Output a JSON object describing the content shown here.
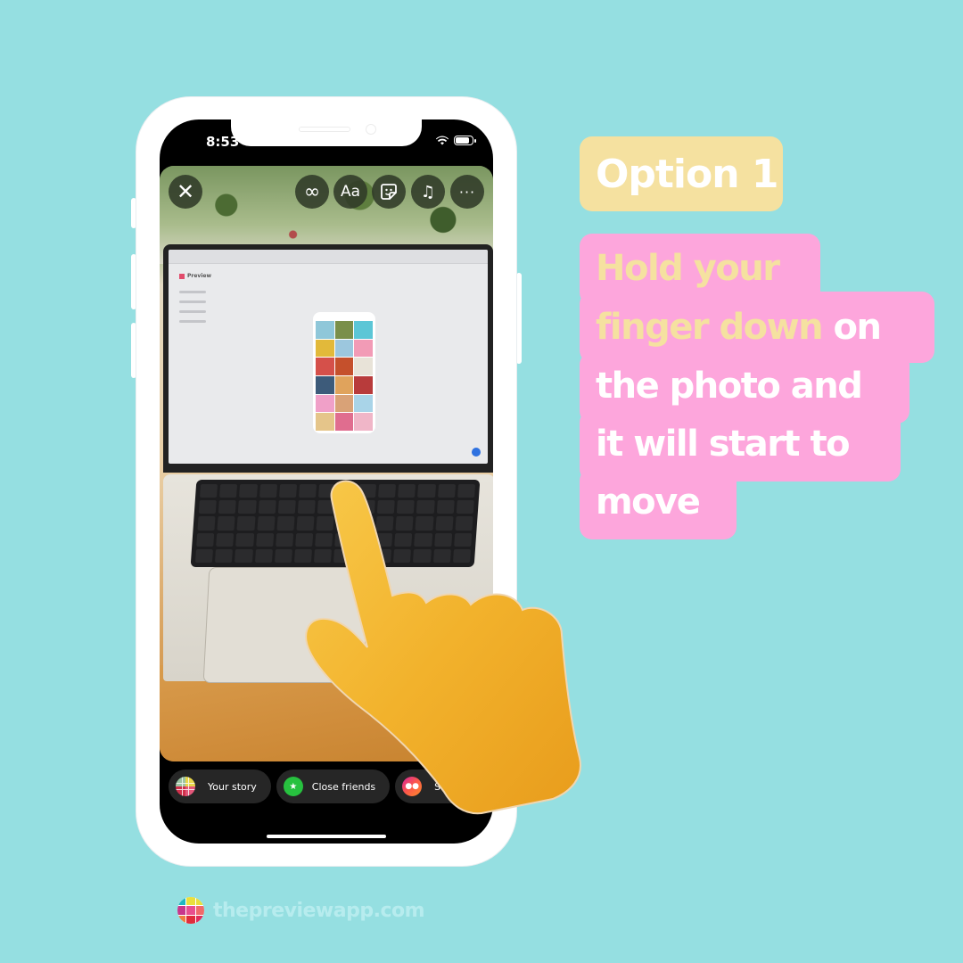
{
  "phone": {
    "status_bar": {
      "time": "8:53",
      "wifi_icon": "wifi-icon",
      "battery_icon": "battery-icon"
    },
    "story_editor": {
      "toolbar": [
        {
          "id": "close",
          "icon": "close-icon",
          "glyph": "✕"
        },
        {
          "id": "boomerang",
          "icon": "infinity-icon",
          "glyph": "∞"
        },
        {
          "id": "text",
          "icon": "text-icon",
          "glyph": "Aa"
        },
        {
          "id": "sticker",
          "icon": "sticker-icon",
          "glyph": "☺"
        },
        {
          "id": "music",
          "icon": "music-icon",
          "glyph": "♫"
        },
        {
          "id": "more",
          "icon": "more-icon",
          "glyph": "···"
        }
      ],
      "photo_laptop_app_title": "Preview",
      "share_options": [
        {
          "label": "Your story",
          "icon": "your-story-avatar"
        },
        {
          "label": "Close friends",
          "icon": "star-icon",
          "glyph": "★"
        },
        {
          "label": "Share",
          "icon": "group-icon",
          "glyph": "👥"
        }
      ]
    },
    "overlay_icon": "pointing-hand-icon"
  },
  "callout": {
    "option_label": "Option 1",
    "instruction": {
      "highlight_text": "Hold your finger down",
      "rest_text": "on the photo and it will start to move",
      "lines": [
        {
          "hl": "Hold your",
          "text": ""
        },
        {
          "hl": "finger down",
          "text": " on"
        },
        {
          "hl": "",
          "text": "the photo and"
        },
        {
          "hl": "",
          "text": "it will start to"
        },
        {
          "hl": "",
          "text": "move"
        }
      ]
    }
  },
  "footer": {
    "url": "thepreviewapp.com",
    "logo_icon": "preview-app-logo"
  },
  "colors": {
    "background": "#95dfe1",
    "option_badge": "#f5e1a0",
    "instruction_bg": "#fda6dc",
    "highlight_text": "#f5e1a0",
    "text": "#ffffff"
  }
}
